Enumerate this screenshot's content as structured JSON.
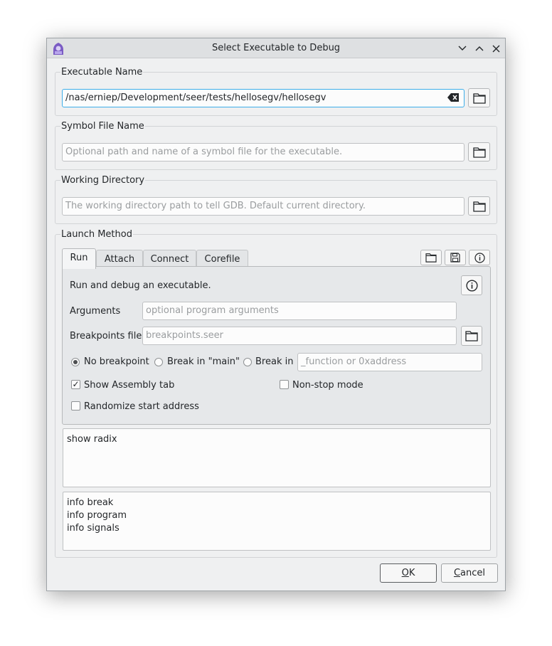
{
  "window": {
    "title": "Select Executable to Debug",
    "controls": [
      "minimize",
      "maximize",
      "close"
    ]
  },
  "executable": {
    "group_title": "Executable Name",
    "value": "/nas/erniep/Development/seer/tests/hellosegv/hellosegv"
  },
  "symbol_file": {
    "group_title": "Symbol File Name",
    "placeholder": "Optional path and name of a symbol file for the executable."
  },
  "working_directory": {
    "group_title": "Working Directory",
    "placeholder": "The working directory path to tell GDB. Default current directory."
  },
  "launch": {
    "group_title": "Launch Method",
    "tabs": [
      {
        "label": "Run",
        "active": true
      },
      {
        "label": "Attach",
        "active": false
      },
      {
        "label": "Connect",
        "active": false
      },
      {
        "label": "Corefile",
        "active": false
      }
    ],
    "run": {
      "description": "Run and debug an executable.",
      "arguments_label": "Arguments",
      "arguments_placeholder": "optional program arguments",
      "breakpoints_label": "Breakpoints file",
      "breakpoints_placeholder": "breakpoints.seer",
      "radio_no_breakpoint": "No breakpoint",
      "radio_break_main": "Break in \"main\"",
      "radio_break_in": "Break in",
      "break_in_placeholder": "_function or 0xaddress",
      "show_assembly_label": "Show Assembly tab",
      "show_assembly_checked": true,
      "non_stop_label": "Non-stop mode",
      "non_stop_checked": false,
      "randomize_label": "Randomize start address",
      "randomize_checked": false
    },
    "pre_commands": [
      "show radix"
    ],
    "post_commands": [
      "info break",
      "info program",
      "info signals"
    ]
  },
  "buttons": {
    "ok_prefix": "O",
    "ok_rest": "K",
    "cancel_prefix": "C",
    "cancel_rest": "ancel"
  },
  "colors": {
    "focus_border": "#3daee9",
    "window_bg": "#eff0f1",
    "logo_purple": "#7b5cc4"
  }
}
